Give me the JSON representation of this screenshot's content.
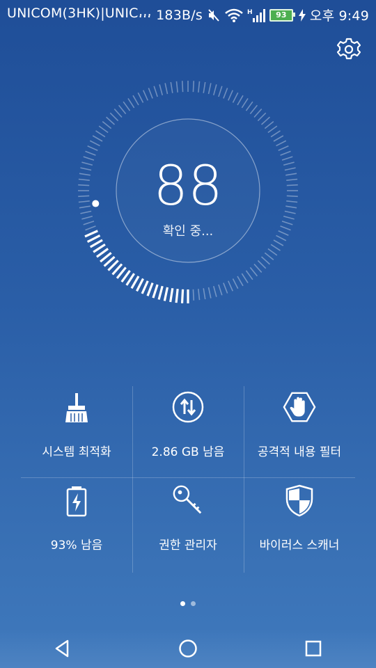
{
  "status_bar": {
    "carrier": "UNICOM(3HK)|UNIC...",
    "speed": "··· 183B/s",
    "battery": "93",
    "time": "오후 9:49",
    "network_type": "H"
  },
  "header": {
    "settings_icon": "gear-icon"
  },
  "gauge": {
    "score": "88",
    "status": "확인 중...",
    "progress": 0.3
  },
  "tools": [
    {
      "label": "시스템 최적화",
      "icon": "broom-icon"
    },
    {
      "label": "2.86 GB 남음",
      "icon": "data-transfer-icon"
    },
    {
      "label": "공격적 내용 필터",
      "icon": "hand-block-icon"
    },
    {
      "label": "93% 남음",
      "icon": "battery-icon"
    },
    {
      "label": "권한 관리자",
      "icon": "key-icon"
    },
    {
      "label": "바이러스 스캐너",
      "icon": "shield-icon"
    }
  ],
  "pager": {
    "pages": 2,
    "active": 0
  },
  "nav": {
    "back": "back-icon",
    "home": "home-icon",
    "recents": "recents-icon"
  }
}
